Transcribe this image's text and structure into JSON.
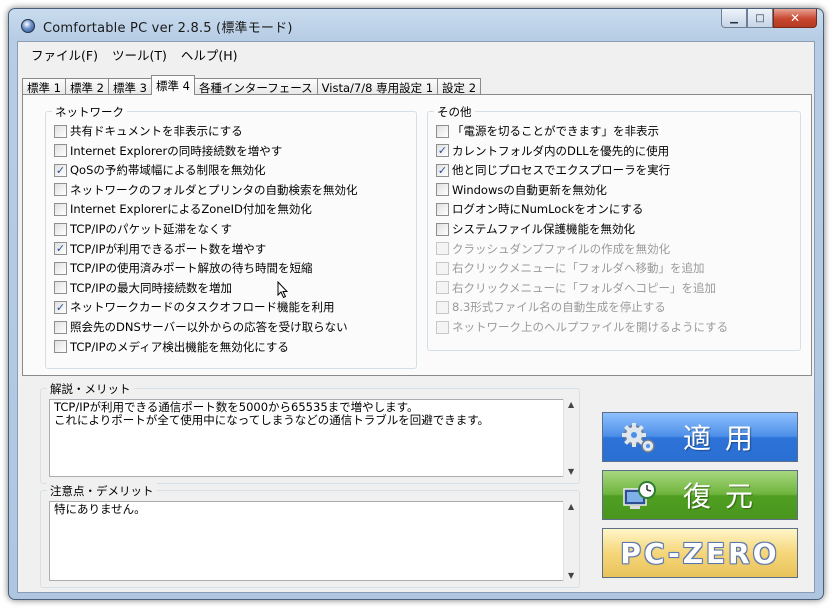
{
  "window": {
    "title": "Comfortable PC ver 2.8.5 (標準モード)"
  },
  "menu": [
    "ファイル(F)",
    "ツール(T)",
    "ヘルプ(H)"
  ],
  "tabs": [
    "標準 1",
    "標準 2",
    "標準 3",
    "標準 4",
    "各種インターフェース",
    "Vista/7/8 専用設定 1",
    "設定 2"
  ],
  "active_tab": "標準 4",
  "network": {
    "label": "ネットワーク",
    "items": [
      {
        "label": "共有ドキュメントを非表示にする",
        "checked": false,
        "enabled": true
      },
      {
        "label": "Internet Explorerの同時接続数を増やす",
        "checked": false,
        "enabled": true
      },
      {
        "label": "QoSの予約帯域幅による制限を無効化",
        "checked": true,
        "enabled": true
      },
      {
        "label": "ネットワークのフォルダとプリンタの自動検索を無効化",
        "checked": false,
        "enabled": true
      },
      {
        "label": "Internet ExplorerによるZoneID付加を無効化",
        "checked": false,
        "enabled": true
      },
      {
        "label": "TCP/IPのパケット延滞をなくす",
        "checked": false,
        "enabled": true
      },
      {
        "label": "TCP/IPが利用できるポート数を増やす",
        "checked": true,
        "enabled": true
      },
      {
        "label": "TCP/IPの使用済みポート解放の待ち時間を短縮",
        "checked": false,
        "enabled": true
      },
      {
        "label": "TCP/IPの最大同時接続数を増加",
        "checked": false,
        "enabled": true
      },
      {
        "label": "ネットワークカードのタスクオフロード機能を利用",
        "checked": true,
        "enabled": true
      },
      {
        "label": "照会先のDNSサーバー以外からの応答を受け取らない",
        "checked": false,
        "enabled": true
      },
      {
        "label": "TCP/IPのメディア検出機能を無効化にする",
        "checked": false,
        "enabled": true
      }
    ]
  },
  "other": {
    "label": "その他",
    "items": [
      {
        "label": "「電源を切ることができます」を非表示",
        "checked": false,
        "enabled": true
      },
      {
        "label": "カレントフォルダ内のDLLを優先的に使用",
        "checked": true,
        "enabled": true
      },
      {
        "label": "他と同じプロセスでエクスプローラを実行",
        "checked": true,
        "enabled": true
      },
      {
        "label": "Windowsの自動更新を無効化",
        "checked": false,
        "enabled": true
      },
      {
        "label": "ログオン時にNumLockをオンにする",
        "checked": false,
        "enabled": true
      },
      {
        "label": "システムファイル保護機能を無効化",
        "checked": false,
        "enabled": true
      },
      {
        "label": "クラッシュダンプファイルの作成を無効化",
        "checked": false,
        "enabled": false
      },
      {
        "label": "右クリックメニューに「フォルダへ移動」を追加",
        "checked": false,
        "enabled": false
      },
      {
        "label": "右クリックメニューに「フォルダへコピー」を追加",
        "checked": false,
        "enabled": false
      },
      {
        "label": "8.3形式ファイル名の自動生成を停止する",
        "checked": false,
        "enabled": false
      },
      {
        "label": "ネットワーク上のヘルプファイルを開けるようにする",
        "checked": false,
        "enabled": false
      }
    ]
  },
  "description": {
    "label": "解説・メリット",
    "text": "TCP/IPが利用できる通信ポート数を5000から65535まで増やします。\nこれによりポートが全て使用中になってしまうなどの通信トラブルを回避できます。"
  },
  "caution": {
    "label": "注意点・デメリット",
    "text": "特にありません。"
  },
  "buttons": {
    "apply": "適用",
    "restore": "復元",
    "pczero": "PC-ZERO"
  }
}
